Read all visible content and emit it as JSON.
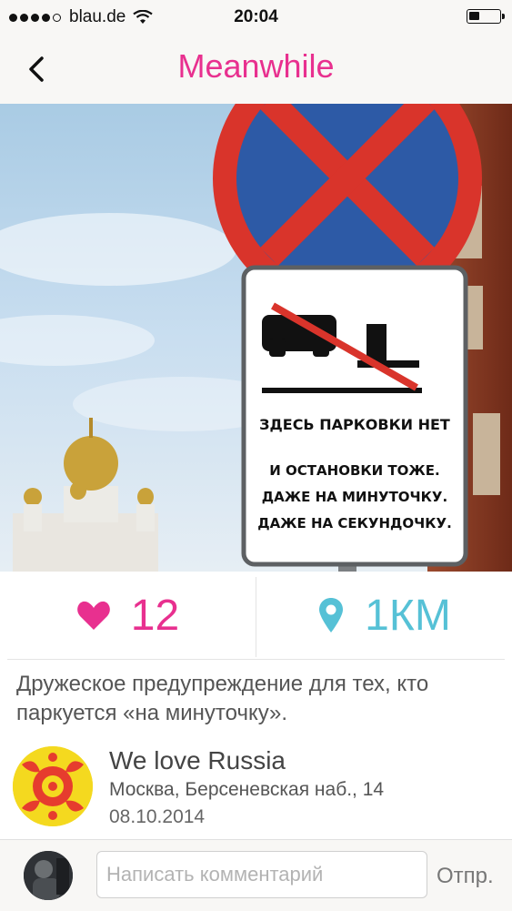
{
  "status_bar": {
    "carrier": "blau.de",
    "time": "20:04",
    "icons": [
      "signal-dots-icon",
      "wifi-icon",
      "battery-icon"
    ]
  },
  "nav": {
    "back_icon": "chevron-left-icon",
    "title": "Meanwhile"
  },
  "photo": {
    "sign_text": {
      "line1": "ЗДЕСЬ ПАРКОВКИ НЕТ",
      "line2": "И ОСТАНОВКИ ТОЖЕ.",
      "line3": "ДАЖЕ НА МИНУТОЧКУ.",
      "line4": "ДАЖЕ НА СЕКУНДОЧКУ."
    }
  },
  "stats": {
    "likes": "12",
    "distance": "1КМ",
    "like_icon": "heart-icon",
    "distance_icon": "map-pin-icon"
  },
  "post": {
    "description": "Дружеское предупреждение для тех, кто паркуется «на минуточку»."
  },
  "author": {
    "name": "We love Russia",
    "address": "Москва, Берсеневская наб., 14",
    "date": "08.10.2014"
  },
  "composer": {
    "placeholder": "Написать комментарий",
    "value": "",
    "send_label": "Отпр."
  },
  "colors": {
    "accent_pink": "#e8308f",
    "accent_teal": "#56c1d6",
    "bar_bg": "#f8f7f5"
  }
}
